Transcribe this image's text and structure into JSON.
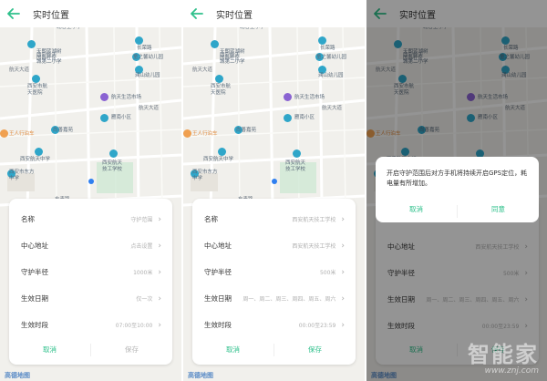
{
  "screens": [
    {
      "title": "实时位置",
      "rows": [
        {
          "label": "名称",
          "value": "守护范围"
        },
        {
          "label": "中心地址",
          "value": "点击设置"
        },
        {
          "label": "守护半径",
          "value": "1000米"
        },
        {
          "label": "生效日期",
          "value": "仅一次"
        },
        {
          "label": "生效时段",
          "value": "07:00至10:00"
        }
      ],
      "cancel_label": "取消",
      "save_label": "保存"
    },
    {
      "title": "实时位置",
      "rows": [
        {
          "label": "名称",
          "value": "西安航天技工学校"
        },
        {
          "label": "中心地址",
          "value": "西安航天技工学校"
        },
        {
          "label": "守护半径",
          "value": "500米"
        },
        {
          "label": "生效日期",
          "value": "周一、周二、周三、周四、周五、周六"
        },
        {
          "label": "生效时段",
          "value": "00:00至23:59"
        }
      ],
      "cancel_label": "取消",
      "save_label": "保存"
    },
    {
      "title": "实时位置",
      "rows": [
        {
          "label": "中心地址",
          "value": "西安航天技工学校"
        },
        {
          "label": "守护半径",
          "value": "500米"
        },
        {
          "label": "生效日期",
          "value": "周一、周二、周三、周四、周五、周六"
        },
        {
          "label": "生效时段",
          "value": "00:00至23:59"
        }
      ],
      "cancel_label": "取消",
      "save_label": "保存",
      "dialog": {
        "message": "开启守护范围后对方手机将持续开启GPS定位，耗电量有所增加。",
        "cancel_label": "取消",
        "confirm_label": "同意"
      }
    }
  ],
  "map": {
    "attribution": "高德地图",
    "labels": {
      "p1": "北客王小学",
      "p2": "长荣路",
      "p3": "天朗蓝湖树\n国际社区",
      "p4": "童之馨幼儿园",
      "p5": "西安航天\n城第二小学",
      "p6": "澜山幼儿园",
      "p7": "航天大道",
      "p8": "西安市航\n天医院",
      "p9": "航天生活市场",
      "p10": "雁南小区",
      "p11": "航天大道",
      "p12": "尚善嘉苑",
      "p13": "王人行泊车",
      "p14": "西安航天中学",
      "p15": "西安航天\n技工学校",
      "p16": "西安市东方\n中学",
      "p17": "东青路"
    }
  },
  "watermark": {
    "big": "智能家",
    "small": "www.znj.com"
  },
  "colors": {
    "accent": "#2ec08b",
    "location": "#2f7ff0",
    "poi_teal": "#2fa6c9",
    "poi_purple": "#8a63d2"
  }
}
